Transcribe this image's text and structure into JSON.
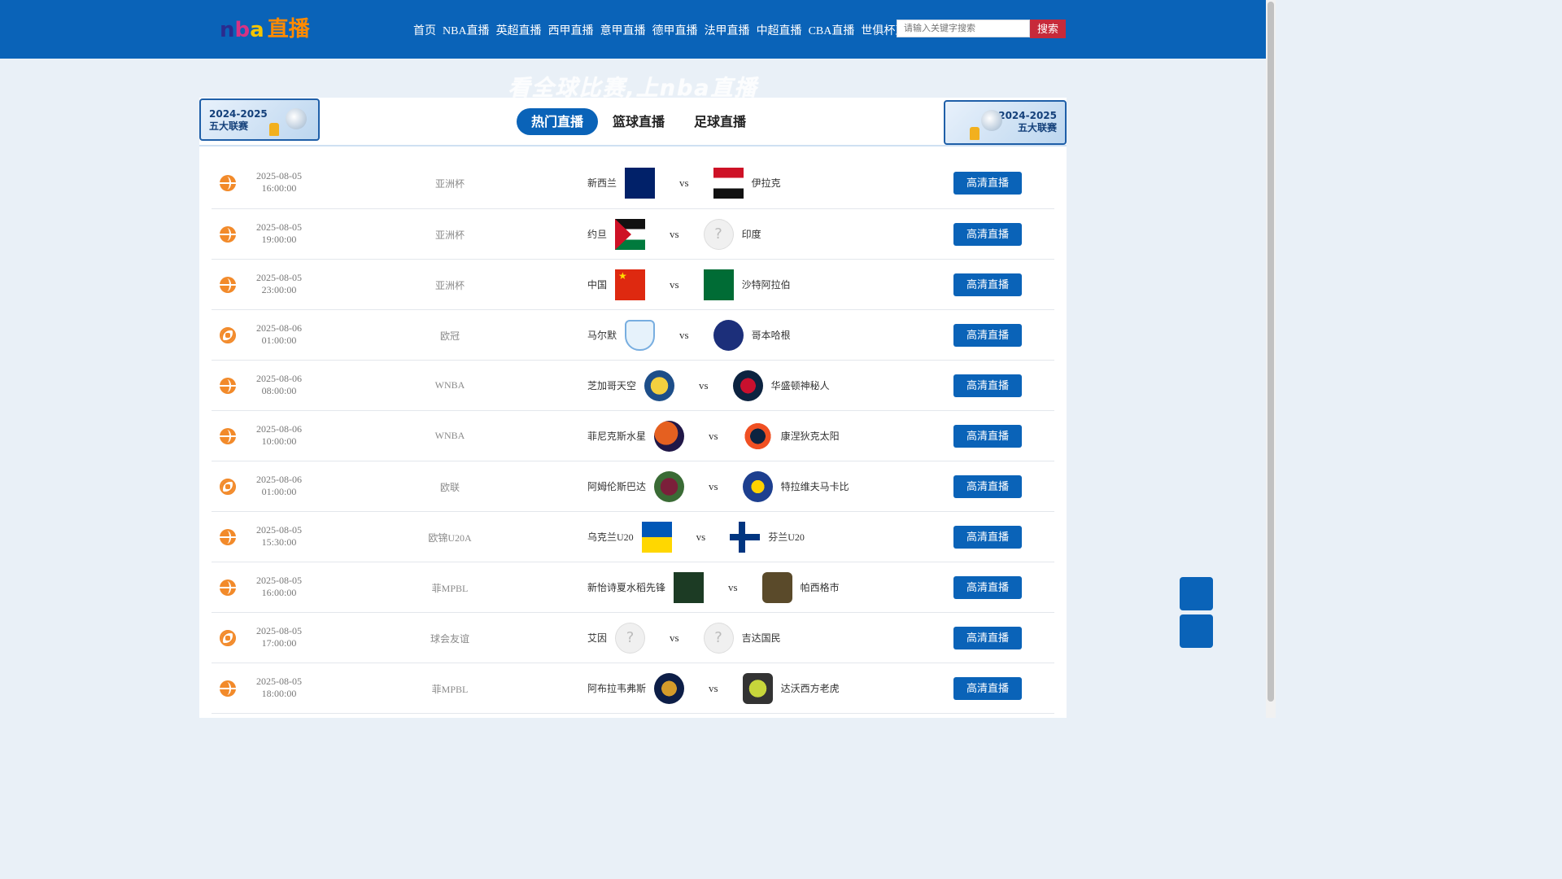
{
  "logo": {
    "part1": "n",
    "part2": "b",
    "part3": "a",
    "part4": "直播"
  },
  "nav": [
    "首页",
    "NBA直播",
    "英超直播",
    "西甲直播",
    "意甲直播",
    "德甲直播",
    "法甲直播",
    "中超直播",
    "CBA直播",
    "世俱杯直播"
  ],
  "search": {
    "placeholder": "请输入关键字搜索",
    "button": "搜索"
  },
  "slogan": "看全球比赛,上nba直播",
  "banner": {
    "line1": "2024-2025",
    "line2": "五大联赛"
  },
  "tabs": [
    {
      "label": "热门直播",
      "active": true
    },
    {
      "label": "篮球直播",
      "active": false
    },
    {
      "label": "足球直播",
      "active": false
    }
  ],
  "matches": [
    {
      "sport": "basketball",
      "date": "2025-08-05",
      "time": "16:00:00",
      "league": "亚洲杯",
      "home": "新西兰",
      "home_logo": "flag-nz",
      "away": "伊拉克",
      "away_logo": "flag-iraq",
      "button": "高清直播"
    },
    {
      "sport": "basketball",
      "date": "2025-08-05",
      "time": "19:00:00",
      "league": "亚洲杯",
      "home": "约旦",
      "home_logo": "flag-jordan",
      "away": "印度",
      "away_logo": "unknown",
      "button": "高清直播"
    },
    {
      "sport": "basketball",
      "date": "2025-08-05",
      "time": "23:00:00",
      "league": "亚洲杯",
      "home": "中国",
      "home_logo": "flag-china",
      "away": "沙特阿拉伯",
      "away_logo": "flag-saudi",
      "button": "高清直播"
    },
    {
      "sport": "football",
      "date": "2025-08-06",
      "time": "01:00:00",
      "league": "欧冠",
      "home": "马尔默",
      "home_logo": "c-malmo",
      "away": "哥本哈根",
      "away_logo": "c-copen",
      "button": "高清直播"
    },
    {
      "sport": "basketball",
      "date": "2025-08-06",
      "time": "08:00:00",
      "league": "WNBA",
      "home": "芝加哥天空",
      "home_logo": "c-sky",
      "away": "华盛顿神秘人",
      "away_logo": "c-mystics",
      "button": "高清直播"
    },
    {
      "sport": "basketball",
      "date": "2025-08-06",
      "time": "10:00:00",
      "league": "WNBA",
      "home": "菲尼克斯水星",
      "home_logo": "c-mercury",
      "away": "康涅狄克太阳",
      "away_logo": "c-sun",
      "button": "高清直播"
    },
    {
      "sport": "football",
      "date": "2025-08-06",
      "time": "01:00:00",
      "league": "欧联",
      "home": "阿姆伦斯巴达",
      "home_logo": "c-amaz",
      "away": "特拉维夫马卡比",
      "away_logo": "c-maccabi",
      "button": "高清直播"
    },
    {
      "sport": "basketball",
      "date": "2025-08-05",
      "time": "15:30:00",
      "league": "欧锦U20A",
      "home": "乌克兰U20",
      "home_logo": "flag-ukraine",
      "away": "芬兰U20",
      "away_logo": "flag-finland",
      "button": "高清直播"
    },
    {
      "sport": "basketball",
      "date": "2025-08-05",
      "time": "16:00:00",
      "league": "菲MPBL",
      "home": "新怡诗夏水稻先锋",
      "home_logo": "c-mpbl1",
      "away": "帕西格市",
      "away_logo": "c-mpbl2",
      "button": "高清直播"
    },
    {
      "sport": "football",
      "date": "2025-08-05",
      "time": "17:00:00",
      "league": "球会友谊",
      "home": "艾因",
      "home_logo": "unknown",
      "away": "吉达国民",
      "away_logo": "unknown",
      "button": "高清直播"
    },
    {
      "sport": "basketball",
      "date": "2025-08-05",
      "time": "18:00:00",
      "league": "菲MPBL",
      "home": "阿布拉韦弗斯",
      "home_logo": "c-bacolod",
      "away": "达沃西方老虎",
      "away_logo": "c-tigers",
      "button": "高清直播"
    }
  ],
  "vs_label": "vs",
  "unknown_glyph": "?"
}
